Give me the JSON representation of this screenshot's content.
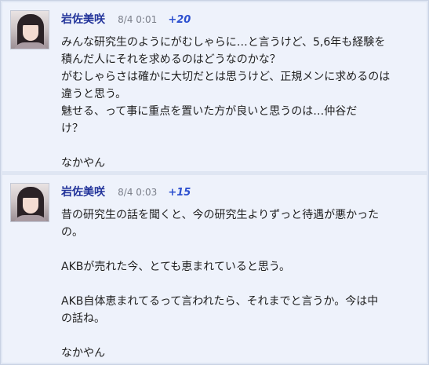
{
  "posts": [
    {
      "author": "岩佐美咲",
      "time": "8/4 0:01",
      "plus": "+20",
      "lines": [
        "みんな研究生のようにがむしゃらに…と言うけど、5,6年も経験を",
        "積んだ人にそれを求めるのはどうなのかな？",
        "がむしゃらさは確かに大切だとは思うけど、正規メンに求めるのは",
        "違うと思う。",
        "魅せる、って事に重点を置いた方が良いと思うのは…仲谷だ",
        "け？",
        "",
        "なかやん"
      ]
    },
    {
      "author": "岩佐美咲",
      "time": "8/4 0:03",
      "plus": "+15",
      "lines": [
        "昔の研究生の話を聞くと、今の研究生よりずっと待遇が悪かった",
        "の。",
        "",
        "AKBが売れた今、とても恵まれていると思う。",
        "",
        "AKB自体恵まれてるって言われたら、それまでと言うか。今は中",
        "の話ね。",
        "",
        "なかやん"
      ]
    }
  ],
  "colors": {
    "author": "#22339a",
    "plus": "#2c4fcf",
    "time": "#7b7f8a",
    "card_bg": "#eef2fb",
    "separator": "#dfe6f3"
  }
}
